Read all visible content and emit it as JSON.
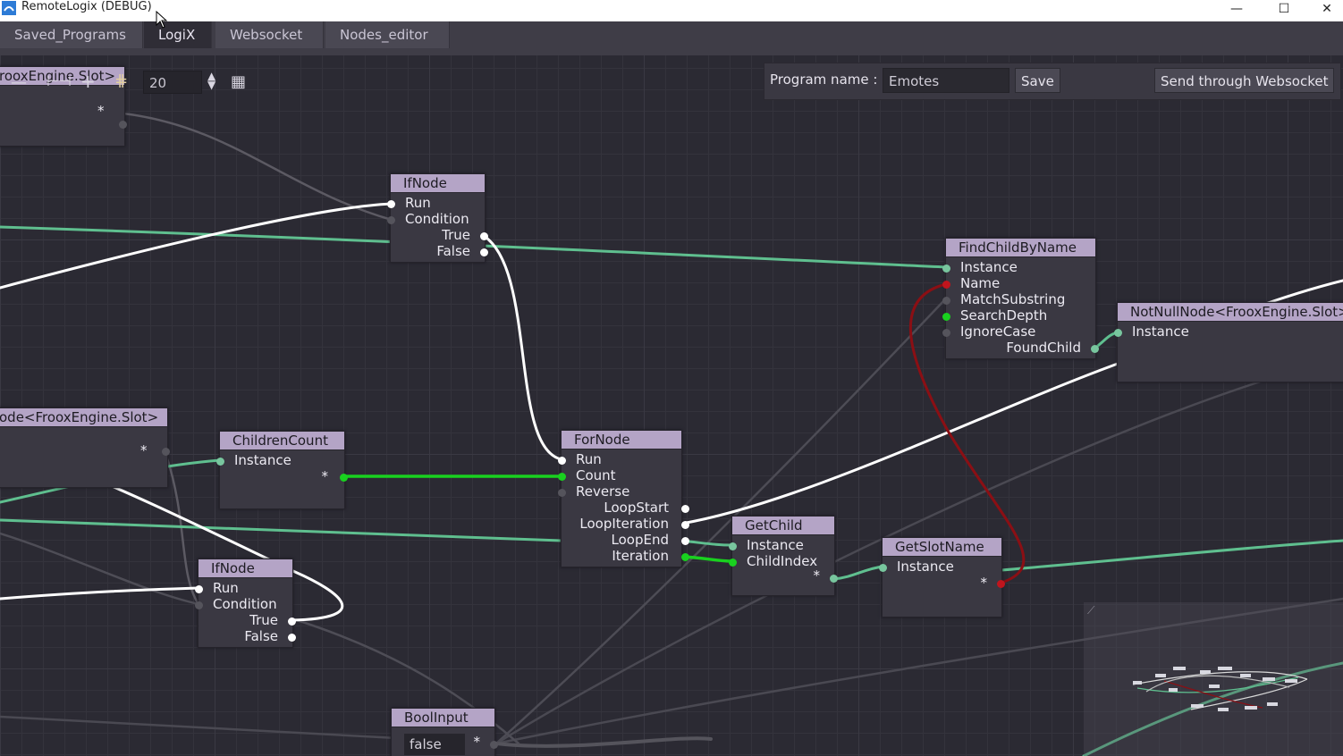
{
  "window": {
    "title": "RemoteLogix (DEBUG)",
    "minimize_glyph": "—",
    "maximize_glyph": "☐",
    "close_glyph": "✕"
  },
  "tabs": [
    {
      "label": "Saved_Programs"
    },
    {
      "label": "LogiX"
    },
    {
      "label": "Websocket"
    },
    {
      "label": "Nodes_editor"
    }
  ],
  "active_tab": "LogiX",
  "toolbar": {
    "zoom_value": "20"
  },
  "program": {
    "label": "Program name :",
    "name_value": "Emotes",
    "save_label": "Save",
    "send_label": "Send through Websocket"
  },
  "nodes": {
    "slot_node_top": {
      "title": "rooxEngine.Slot>",
      "out_star": "*"
    },
    "ifnode_top": {
      "title": "IfNode",
      "inputs": [
        "Run",
        "Condition"
      ],
      "outputs": [
        "True",
        "False"
      ]
    },
    "findchildbyname": {
      "title": "FindChildByName",
      "inputs": [
        "Instance",
        "Name",
        "MatchSubstring",
        "SearchDepth",
        "IgnoreCase"
      ],
      "outputs": [
        "FoundChild"
      ]
    },
    "notnullnode": {
      "title": "NotNullNode<FrooxEngine.Slot>",
      "inputs": [
        "Instance"
      ]
    },
    "slot_node_left": {
      "title": "ode<FrooxEngine.Slot>",
      "out_star": "*"
    },
    "childrencount": {
      "title": "ChildrenCount",
      "inputs": [
        "Instance"
      ],
      "out_star": "*"
    },
    "fornode": {
      "title": "ForNode",
      "inputs": [
        "Run",
        "Count",
        "Reverse"
      ],
      "outputs": [
        "LoopStart",
        "LoopIteration",
        "LoopEnd",
        "Iteration"
      ]
    },
    "getchild": {
      "title": "GetChild",
      "inputs": [
        "Instance",
        "ChildIndex"
      ],
      "out_star": "*"
    },
    "getslotname": {
      "title": "GetSlotName",
      "inputs": [
        "Instance"
      ],
      "out_star": "*"
    },
    "ifnode_bottom": {
      "title": "IfNode",
      "inputs": [
        "Run",
        "Condition"
      ],
      "outputs": [
        "True",
        "False"
      ]
    },
    "boolinput": {
      "title": "BoolInput",
      "value": "false",
      "out_star": "*"
    }
  },
  "colors": {
    "impulse_wire": "#ffffff",
    "slot_wire": "#5fbf8f",
    "int_wire": "#19d11f",
    "string_wire": "#8b0f14",
    "node_header": "#b4a4c6"
  }
}
